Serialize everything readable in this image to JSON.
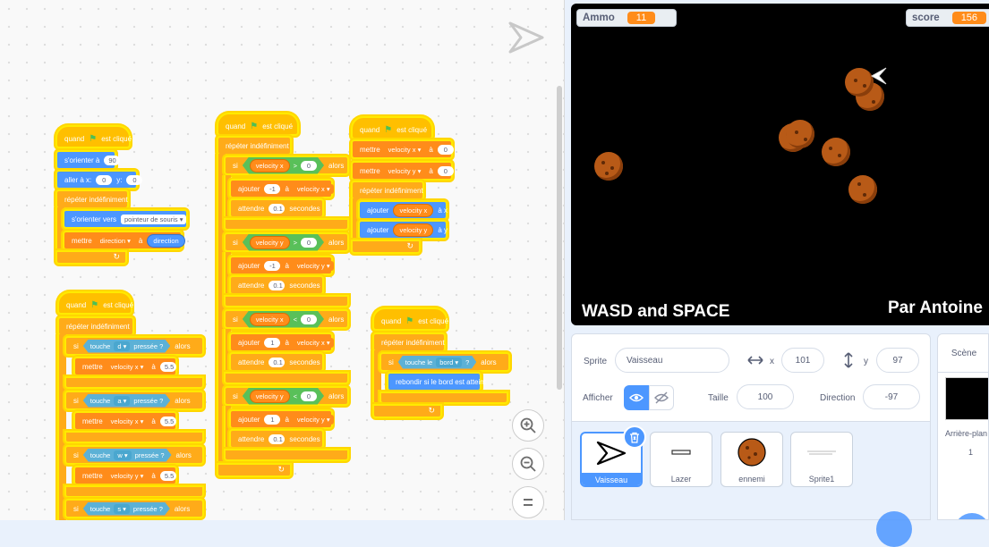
{
  "blocks": {
    "when_flag": "quand",
    "clicked": "est cliqué",
    "forever": "répéter indéfiniment",
    "if": "si",
    "then": "alors",
    "point_dir": "s'orienter à",
    "point_dir_val": "90",
    "goto": "aller à x:",
    "goto_x": "0",
    "goto_y_lbl": "y:",
    "goto_y": "0",
    "point_towards": "s'orienter vers",
    "mouse_pointer": "pointeur de souris",
    "set": "mettre",
    "to": "à",
    "add": "ajouter",
    "wait": "attendre",
    "seconds": "secondes",
    "direction": "direction",
    "vel_x": "velocity x",
    "vel_y": "velocity y",
    "key": "touche",
    "pressed": "pressée ?",
    "key_d": "d",
    "key_a": "a",
    "key_w": "w",
    "key_s": "s",
    "val_55": "5.5",
    "val_m1": "-1",
    "val_1": "1",
    "val_01": "0.1",
    "val_0": "0",
    "gt": ">",
    "lt": "<",
    "at_x": "à x",
    "at_y": "à y",
    "touching": "touche le",
    "edge": "bord",
    "q": "?",
    "bounce": "rebondir si le bord est atteint"
  },
  "stage": {
    "ammo_label": "Ammo",
    "ammo_value": "11",
    "score_label": "score",
    "score_value": "156",
    "text_left": "WASD and SPACE",
    "text_right": "Par Antoine"
  },
  "sprite_info": {
    "sprite_label": "Sprite",
    "sprite_name": "Vaisseau",
    "x_label": "x",
    "x_value": "101",
    "y_label": "y",
    "y_value": "97",
    "show_label": "Afficher",
    "size_label": "Taille",
    "size_value": "100",
    "direction_label": "Direction",
    "direction_value": "-97"
  },
  "sprites": [
    {
      "name": "Vaisseau"
    },
    {
      "name": "Lazer"
    },
    {
      "name": "ennemi"
    },
    {
      "name": "Sprite1"
    }
  ],
  "scene": {
    "title": "Scène",
    "backdrop_label": "Arrière-plan",
    "backdrop_count": "1"
  },
  "colors": {
    "events": "#ffbf00",
    "control": "#ffab19",
    "motion": "#4c97ff",
    "variables": "#ff8c1a",
    "sensing": "#5cb1d6",
    "operators": "#59c059",
    "highlight": "#ffea00"
  }
}
